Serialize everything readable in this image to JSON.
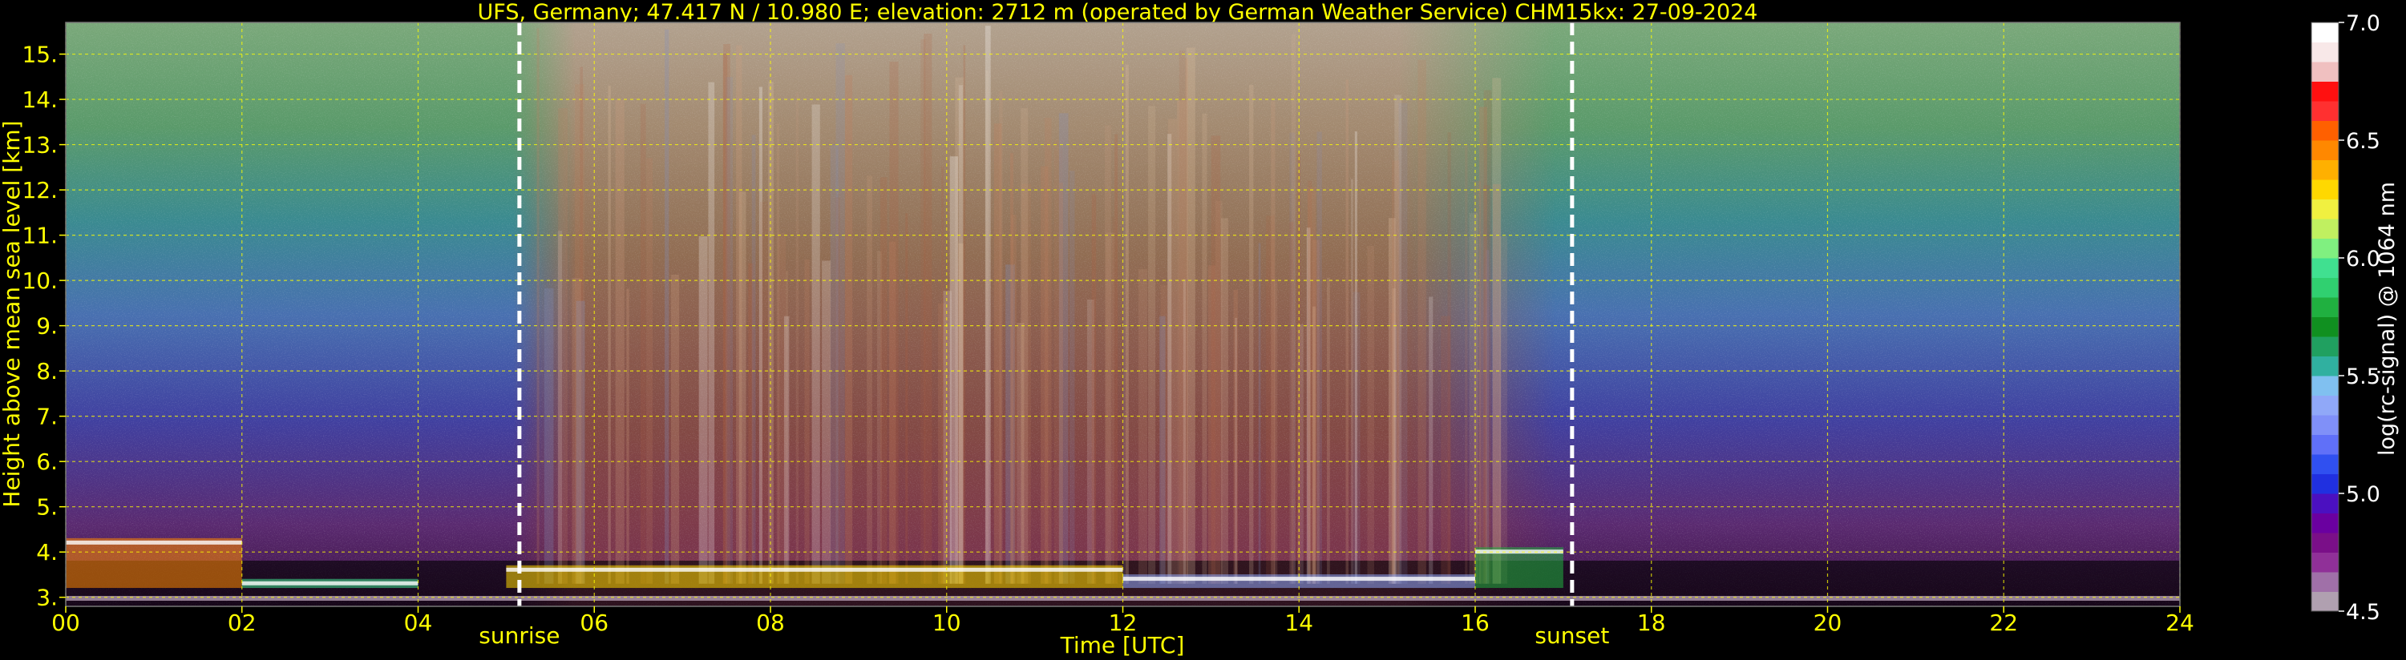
{
  "chart_data": {
    "type": "heatmap",
    "title": "UFS, Germany; 47.417 N / 10.980 E; elevation: 2712 m  (operated by German Weather Service)    CHM15kx: 27-09-2024",
    "xlabel": "Time [UTC]",
    "ylabel": "Height above mean sea level [km]",
    "xlim": [
      0,
      24
    ],
    "ylim": [
      2.8,
      15.7
    ],
    "x_ticks": [
      "00",
      "02",
      "04",
      "06",
      "08",
      "10",
      "12",
      "14",
      "16",
      "18",
      "20",
      "22",
      "24"
    ],
    "y_ticks": [
      "3.",
      "4.",
      "5.",
      "6.",
      "7.",
      "8.",
      "9.",
      "10.",
      "11.",
      "12.",
      "13.",
      "14.",
      "15."
    ],
    "grid": true,
    "events": [
      {
        "label": "sunrise",
        "time": 5.15
      },
      {
        "label": "sunset",
        "time": 17.1
      }
    ],
    "colorbar": {
      "label": "log(rc-signal) @ 1064 nm",
      "range": [
        4.5,
        7.0
      ],
      "ticks": [
        "4.5",
        "5.0",
        "5.5",
        "6.0",
        "6.5",
        "7.0"
      ],
      "colors": [
        "#b0a0b0",
        "#a070a8",
        "#903098",
        "#7a0f88",
        "#6a00a0",
        "#4b10c0",
        "#2030e0",
        "#3050f0",
        "#6070f8",
        "#8090f8",
        "#90a8f8",
        "#80c0f0",
        "#30b0a0",
        "#20a060",
        "#109020",
        "#20b040",
        "#30d070",
        "#40e090",
        "#80f080",
        "#c0f060",
        "#f0f040",
        "#ffd800",
        "#ffb000",
        "#ff8800",
        "#ff6000",
        "#ff3030",
        "#ff1010",
        "#f0c0c0",
        "#f8e8e8",
        "#ffffff"
      ]
    },
    "profile_summary": [
      {
        "period": "00-02",
        "height_km": 4.2,
        "level": 6.5
      },
      {
        "period": "02-04",
        "height_km": 3.3,
        "level": 6.0
      },
      {
        "period": "05-12",
        "height_km": 3.6,
        "level": 6.3
      },
      {
        "period": "12-16",
        "height_km": 3.4,
        "level": 5.4
      },
      {
        "period": "16-17",
        "height_km": 4.0,
        "level": 5.8
      }
    ]
  }
}
